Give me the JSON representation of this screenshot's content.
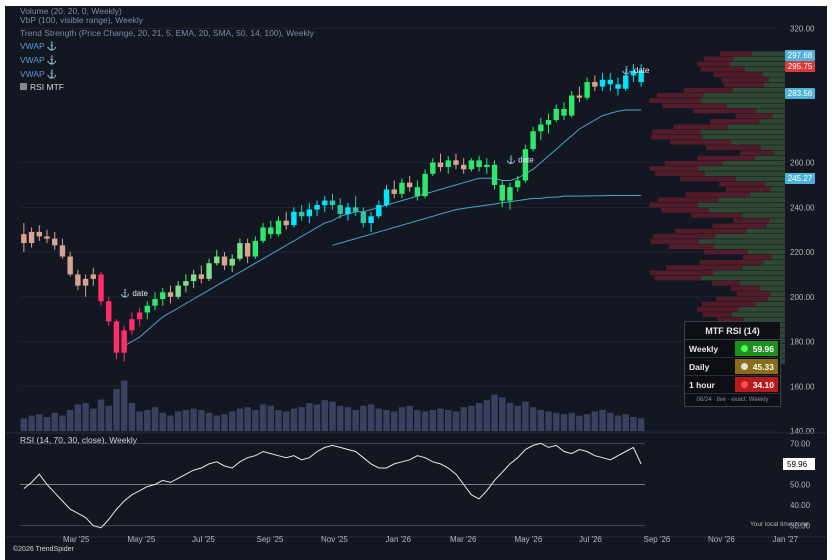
{
  "legend": {
    "volume": "Volume (20, 20, 0, Weekly)",
    "vbp": "VbP (100, visible range), Weekly",
    "trend": "Trend Strength (Price Change, 20, 21, 5, EMA, 20, SMA, 50, 14, 100), Weekly",
    "vwap": "VWAP ⚓",
    "rsi_mtf": "RSI MTF"
  },
  "anchors": [
    "⚓ date",
    "⚓ date",
    "⚓ date"
  ],
  "price_axis": {
    "ticks": [
      "320.00",
      "260.00",
      "240.00",
      "220.00",
      "200.00",
      "180.00",
      "160.00",
      "140.00"
    ]
  },
  "rsi_axis": {
    "ticks": [
      "70.00",
      "60.00",
      "50.00",
      "40.00",
      "30.00"
    ],
    "current": "59.96"
  },
  "rsi_label": "RSI (14, 70, 30, close), Weekly",
  "price_tags": {
    "last": "297.68",
    "prev": "295.75",
    "vwap1": "283.56",
    "vwap2": "245.27"
  },
  "colors": {
    "background": "#131722",
    "up_cyan": "#00e5ff",
    "up_green": "#2ee86b",
    "down_red": "#ff2e6a",
    "neutral": "#d7a48f",
    "sma": "#4fb3d8",
    "volume": "#3a4060",
    "vbp_red": "#6b1f2e",
    "vbp_green": "#3a5a3a"
  },
  "mtf_rsi": {
    "title": "MTF RSI (14)",
    "rows": [
      {
        "label": "Weekly",
        "value": "59.96",
        "color": "#1f8f1f",
        "dot": "#4cff4c"
      },
      {
        "label": "Daily",
        "value": "45.33",
        "color": "#8a6d1a",
        "dot": "#e0e0e0"
      },
      {
        "label": "1 hour",
        "value": "34.10",
        "color": "#b81d1d",
        "dot": "#ff4c4c"
      }
    ],
    "footer": "08/24 · live · exact: Weekly"
  },
  "footer": {
    "copyright": "©2026 TrendSpider",
    "timezone": "Your local time zone"
  },
  "chart_data": {
    "type": "candlestick",
    "x_axis_labels": [
      "Mar '25",
      "May '25",
      "Jul '25",
      "Sep '25",
      "Nov '25",
      "Jan '26",
      "Mar '26",
      "May '26",
      "Jul '26",
      "Sep '26",
      "Nov '26",
      "Jan '27"
    ],
    "y_range": [
      140,
      330
    ],
    "candles": [
      [
        228,
        233,
        220,
        224
      ],
      [
        224,
        231,
        222,
        229
      ],
      [
        229,
        232,
        225,
        227
      ],
      [
        227,
        230,
        224,
        226
      ],
      [
        226,
        229,
        221,
        223
      ],
      [
        223,
        226,
        217,
        218
      ],
      [
        218,
        220,
        209,
        210
      ],
      [
        210,
        212,
        203,
        205
      ],
      [
        205,
        210,
        200,
        208
      ],
      [
        208,
        213,
        205,
        210
      ],
      [
        210,
        211,
        196,
        198
      ],
      [
        198,
        200,
        187,
        189
      ],
      [
        189,
        190,
        172,
        175
      ],
      [
        175,
        187,
        171,
        185
      ],
      [
        185,
        193,
        183,
        190
      ],
      [
        190,
        195,
        187,
        193
      ],
      [
        193,
        198,
        190,
        196
      ],
      [
        196,
        202,
        194,
        199
      ],
      [
        199,
        204,
        196,
        202
      ],
      [
        202,
        205,
        197,
        200
      ],
      [
        200,
        207,
        199,
        205
      ],
      [
        205,
        210,
        202,
        207
      ],
      [
        207,
        212,
        204,
        210
      ],
      [
        210,
        214,
        206,
        208
      ],
      [
        208,
        217,
        207,
        215
      ],
      [
        215,
        221,
        214,
        218
      ],
      [
        218,
        220,
        212,
        214
      ],
      [
        214,
        219,
        211,
        217
      ],
      [
        217,
        226,
        216,
        224
      ],
      [
        224,
        226,
        215,
        218
      ],
      [
        218,
        227,
        217,
        225
      ],
      [
        225,
        233,
        224,
        231
      ],
      [
        231,
        234,
        226,
        228
      ],
      [
        228,
        236,
        227,
        234
      ],
      [
        234,
        238,
        230,
        232
      ],
      [
        232,
        240,
        231,
        238
      ],
      [
        238,
        241,
        234,
        236
      ],
      [
        236,
        242,
        233,
        239
      ],
      [
        239,
        243,
        236,
        241
      ],
      [
        241,
        245,
        238,
        243
      ],
      [
        243,
        246,
        239,
        241
      ],
      [
        241,
        244,
        235,
        237
      ],
      [
        237,
        242,
        234,
        240
      ],
      [
        240,
        245,
        236,
        238
      ],
      [
        238,
        240,
        231,
        233
      ],
      [
        233,
        238,
        229,
        236
      ],
      [
        236,
        243,
        235,
        241
      ],
      [
        241,
        250,
        240,
        248
      ],
      [
        248,
        252,
        244,
        246
      ],
      [
        246,
        253,
        244,
        251
      ],
      [
        251,
        254,
        247,
        249
      ],
      [
        249,
        252,
        243,
        245
      ],
      [
        245,
        257,
        244,
        255
      ],
      [
        255,
        262,
        254,
        260
      ],
      [
        260,
        264,
        256,
        258
      ],
      [
        258,
        263,
        255,
        261
      ],
      [
        261,
        264,
        257,
        259
      ],
      [
        259,
        262,
        255,
        257
      ],
      [
        257,
        262,
        256,
        261
      ],
      [
        261,
        263,
        256,
        258
      ],
      [
        258,
        262,
        255,
        259
      ],
      [
        259,
        261,
        248,
        250
      ],
      [
        250,
        252,
        240,
        243
      ],
      [
        243,
        251,
        239,
        249
      ],
      [
        249,
        254,
        247,
        252
      ],
      [
        252,
        268,
        251,
        266
      ],
      [
        266,
        276,
        265,
        274
      ],
      [
        274,
        280,
        270,
        277
      ],
      [
        277,
        282,
        273,
        279
      ],
      [
        279,
        286,
        278,
        284
      ],
      [
        284,
        287,
        279,
        281
      ],
      [
        281,
        292,
        280,
        290
      ],
      [
        290,
        294,
        287,
        289
      ],
      [
        289,
        298,
        288,
        296
      ],
      [
        296,
        299,
        292,
        294
      ],
      [
        294,
        300,
        292,
        297
      ],
      [
        297,
        300,
        292,
        295
      ],
      [
        295,
        298,
        290,
        293
      ],
      [
        293,
        301,
        292,
        299
      ],
      [
        299,
        304,
        296,
        301
      ],
      [
        301,
        304,
        294,
        296
      ]
    ],
    "volume_scale": [
      0,
      100
    ],
    "volume": [
      18,
      22,
      24,
      20,
      26,
      22,
      30,
      38,
      40,
      32,
      45,
      36,
      60,
      72,
      40,
      28,
      30,
      34,
      26,
      22,
      28,
      30,
      32,
      30,
      26,
      22,
      24,
      28,
      32,
      34,
      30,
      38,
      36,
      30,
      28,
      32,
      34,
      40,
      38,
      44,
      42,
      36,
      34,
      30,
      36,
      38,
      32,
      30,
      28,
      34,
      36,
      30,
      28,
      30,
      32,
      30,
      28,
      34,
      36,
      40,
      44,
      52,
      48,
      40,
      36,
      42,
      34,
      30,
      28,
      26,
      24,
      26,
      22,
      24,
      28,
      30,
      26,
      22,
      24,
      20,
      18
    ],
    "sma20": [
      null,
      null,
      null,
      null,
      null,
      null,
      null,
      null,
      null,
      null,
      null,
      null,
      null,
      178,
      180,
      182,
      185,
      188,
      191,
      193,
      195,
      197,
      199,
      201,
      203,
      205,
      207,
      209,
      211,
      213,
      215,
      217,
      219,
      221,
      223,
      225,
      227,
      229,
      231,
      233,
      234,
      236,
      237,
      238,
      238,
      239,
      240,
      241,
      242,
      243,
      244,
      245,
      246,
      247,
      248,
      249,
      250,
      251,
      252,
      253,
      253,
      253,
      252,
      252,
      253,
      255,
      257,
      260,
      263,
      266,
      269,
      272,
      275,
      277,
      279,
      281,
      282,
      283,
      283.5,
      283.5,
      283.56
    ],
    "sma50": [
      null,
      null,
      null,
      null,
      null,
      null,
      null,
      null,
      null,
      null,
      null,
      null,
      null,
      null,
      null,
      null,
      null,
      null,
      null,
      null,
      null,
      null,
      null,
      null,
      null,
      null,
      null,
      null,
      null,
      null,
      null,
      null,
      null,
      null,
      null,
      null,
      null,
      null,
      null,
      null,
      223,
      224,
      225,
      226,
      227,
      228,
      229,
      230,
      231,
      232,
      233,
      234,
      235,
      236,
      237,
      238,
      239,
      239.5,
      240,
      240.5,
      241,
      241.5,
      242,
      242.5,
      243,
      243.5,
      244,
      244,
      244.5,
      244.5,
      245,
      245,
      245,
      245.1,
      245.2,
      245.2,
      245.27,
      245.27,
      245.27,
      245.27,
      245.27
    ],
    "rsi": [
      48,
      51,
      55,
      50,
      46,
      42,
      38,
      36,
      34,
      30,
      29,
      33,
      38,
      42,
      45,
      47,
      49,
      50,
      52,
      51,
      53,
      55,
      57,
      58,
      60,
      61,
      59,
      58,
      61,
      63,
      64,
      66,
      65,
      64,
      63,
      64,
      62,
      63,
      66,
      68,
      69,
      68,
      67,
      66,
      63,
      60,
      58,
      58,
      60,
      61,
      62,
      64,
      63,
      61,
      60,
      58,
      55,
      50,
      45,
      43,
      47,
      52,
      56,
      60,
      63,
      67,
      69,
      70,
      68,
      69,
      66,
      65,
      67,
      66,
      64,
      63,
      62,
      64,
      66,
      68,
      59.96
    ]
  }
}
